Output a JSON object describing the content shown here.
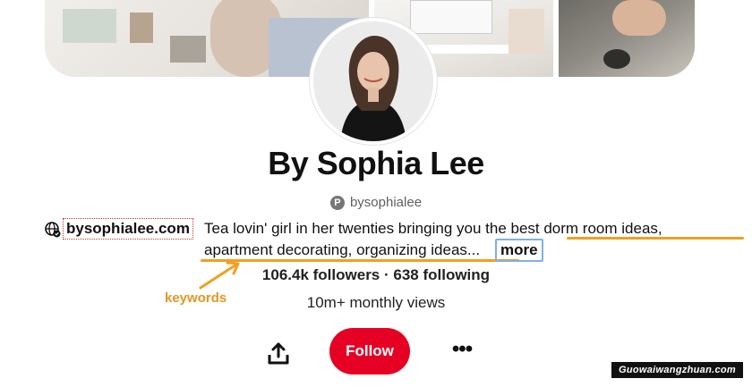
{
  "profile": {
    "name": "By Sophia Lee",
    "handle": "bysophialee",
    "website": "bysophialee.com",
    "bio_line1": "Tea lovin' girl in her twenties bringing you the best dorm room ideas,",
    "bio_line2": "apartment decorating, organizing ideas...",
    "more_label": "more",
    "stats": "106.4k followers · 638 following",
    "monthly_views": "10m+ monthly views"
  },
  "annotation": {
    "keywords_label": "keywords"
  },
  "actions": {
    "follow_label": "Follow",
    "more_options": "•••"
  },
  "icons": {
    "share": "share-icon",
    "globe": "globe-verified-icon",
    "pinterest": "pinterest-icon",
    "more": "more-options-icon"
  },
  "colors": {
    "follow_button": "#e60023",
    "keyword_highlight": "#f0a020",
    "more_box": "#7fb0e6",
    "link_box": "#c0392b"
  },
  "watermark": "Guowaiwangzhuan.com"
}
